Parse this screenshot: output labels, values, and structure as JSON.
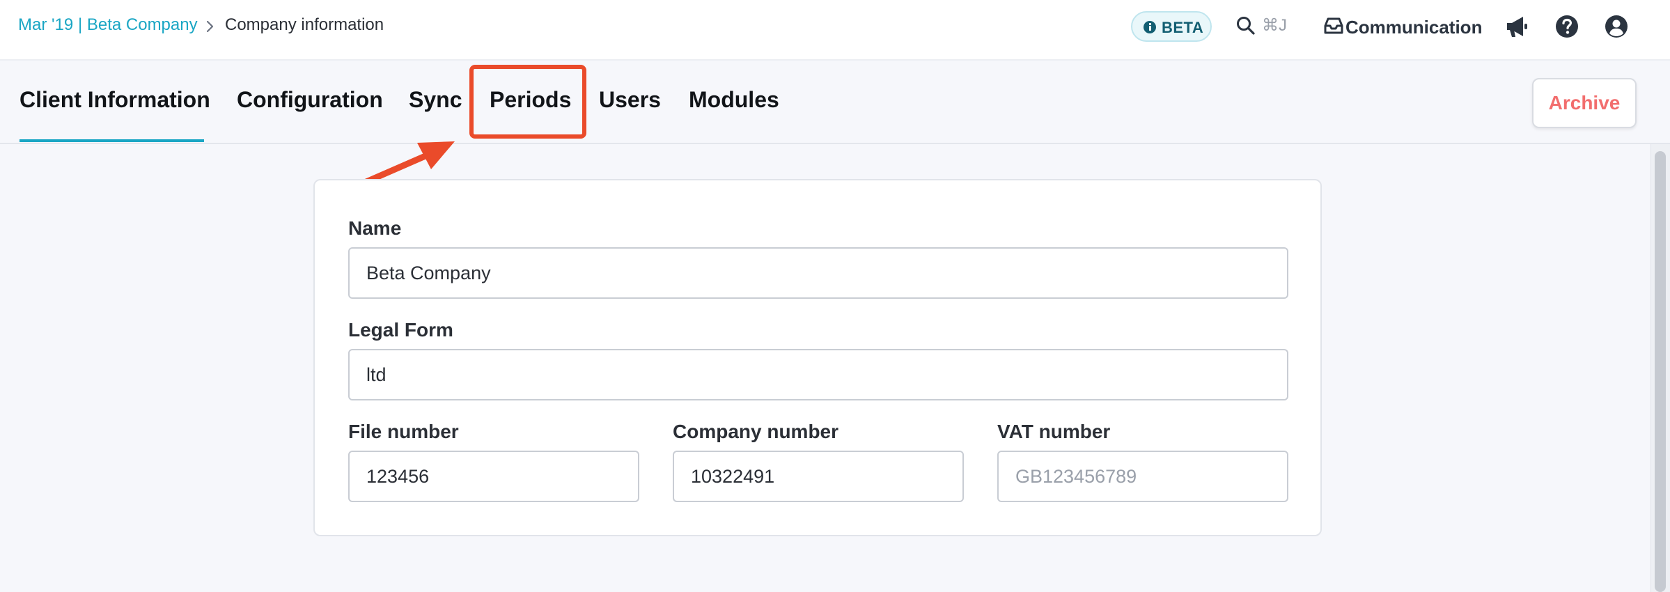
{
  "breadcrumb": {
    "parent": "Mar '19 | Beta Company",
    "current": "Company information"
  },
  "header": {
    "beta_label": "BETA",
    "search_shortcut": "⌘J",
    "communication_label": "Communication",
    "icons": [
      "info-icon",
      "search-icon",
      "inbox-icon",
      "megaphone-icon",
      "help-icon",
      "account-icon"
    ]
  },
  "tabs": [
    {
      "label": "Client Information",
      "active": true
    },
    {
      "label": "Configuration",
      "active": false
    },
    {
      "label": "Sync",
      "active": false
    },
    {
      "label": "Periods",
      "active": false,
      "highlighted": true
    },
    {
      "label": "Users",
      "active": false
    },
    {
      "label": "Modules",
      "active": false
    }
  ],
  "archive_label": "Archive",
  "form": {
    "name": {
      "label": "Name",
      "value": "Beta Company"
    },
    "legal_form": {
      "label": "Legal Form",
      "value": "ltd"
    },
    "file_number": {
      "label": "File number",
      "value": "123456"
    },
    "company_number": {
      "label": "Company number",
      "value": "10322491"
    },
    "vat_number": {
      "label": "VAT number",
      "value": "",
      "placeholder": "GB123456789"
    }
  },
  "colors": {
    "accent": "#1aa6c4",
    "annotation": "#ea4b2a",
    "archive": "#f26d6d",
    "beta_text": "#125e72"
  }
}
